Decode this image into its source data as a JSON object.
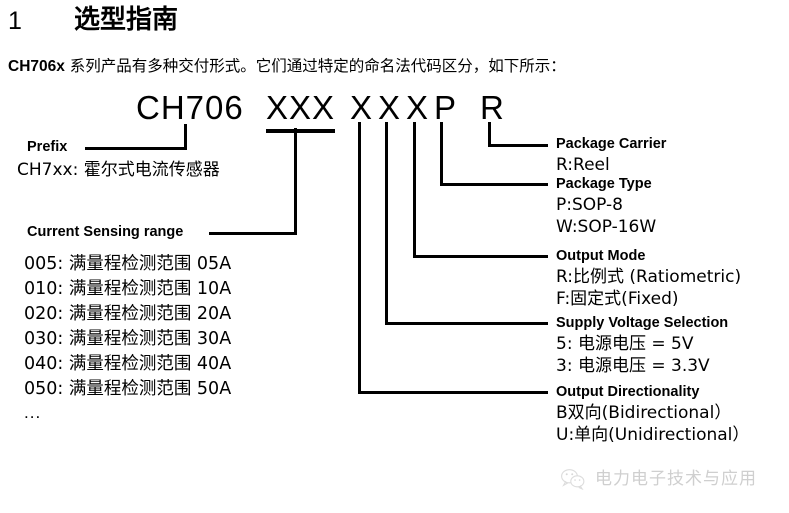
{
  "heading": {
    "number": "1",
    "title": "选型指南"
  },
  "intro": {
    "lead": "CH706x",
    "rest": " 系列产品有多种交付形式。它们通过特定的命名法代码区分，如下所示："
  },
  "part_number": {
    "base": "CH706",
    "range_field": "XXX",
    "char1": "X",
    "char2": "X",
    "char3": "X",
    "char4": "P",
    "char5": "R"
  },
  "left_blocks": {
    "prefix": {
      "heading": "Prefix",
      "lines": [
        "CH7xx: 霍尔式电流传感器"
      ]
    },
    "current_range": {
      "heading": "Current Sensing range",
      "lines": [
        "005: 满量程检测范围 05A",
        "010: 满量程检测范围 10A",
        "020: 满量程检测范围 20A",
        "030: 满量程检测范围 30A",
        "040: 满量程检测范围 40A",
        "050: 满量程检测范围 50A"
      ],
      "ellipsis": "..."
    }
  },
  "right_blocks": {
    "package_carrier": {
      "heading": "Package Carrier",
      "lines": [
        "R:Reel"
      ]
    },
    "package_type": {
      "heading": "Package Type",
      "lines": [
        "P:SOP-8",
        "W:SOP-16W"
      ]
    },
    "output_mode": {
      "heading": "Output Mode",
      "lines": [
        "R:比例式 (Ratiometric)",
        "F:固定式(Fixed)"
      ]
    },
    "supply_voltage": {
      "heading": "Supply Voltage Selection",
      "lines": [
        "5: 电源电压 = 5V",
        "3: 电源电压 = 3.3V"
      ]
    },
    "output_directionality": {
      "heading": "Output Directionality",
      "lines": [
        "B双向(Bidirectional）",
        "U:单向(Unidirectional）"
      ]
    }
  },
  "watermark": {
    "text": "电力电子技术与应用",
    "icon": "wechat-logo-icon",
    "color": "#d2d2d2"
  },
  "colors": {
    "ink": "#000000",
    "page": "#ffffff"
  }
}
